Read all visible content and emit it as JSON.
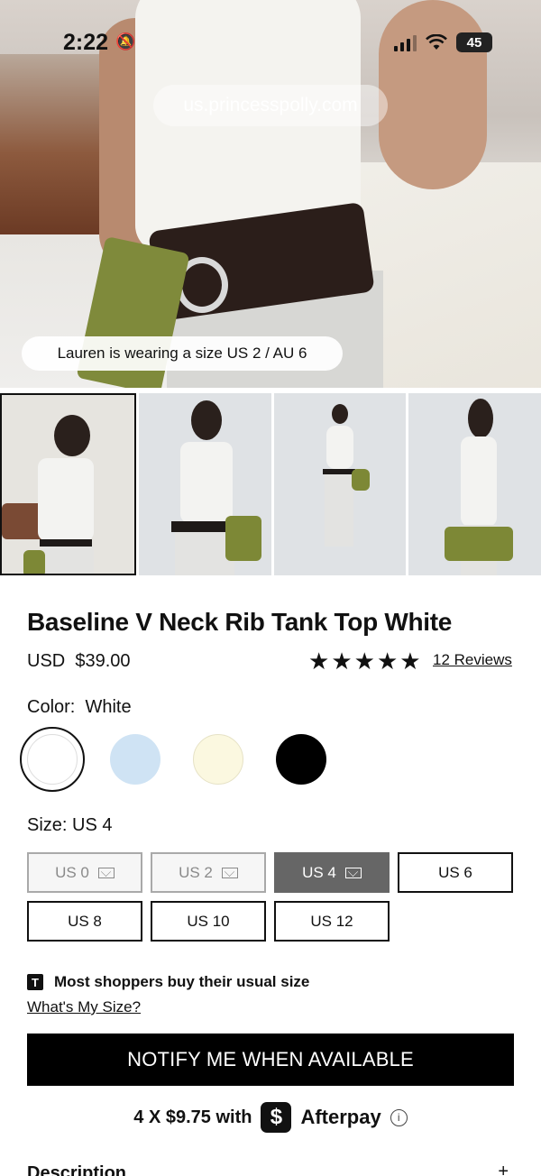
{
  "status_bar": {
    "time": "2:22",
    "battery": "45",
    "icons": [
      "bell-slash-icon",
      "signal-icon",
      "wifi-icon",
      "battery-icon"
    ]
  },
  "browser": {
    "url": "us.princesspolly.com"
  },
  "hero": {
    "model_note": "Lauren is wearing a size US 2 / AU 6"
  },
  "gallery": {
    "thumbnails": [
      "thumb-1",
      "thumb-2",
      "thumb-3",
      "thumb-4"
    ],
    "selected_index": 0
  },
  "product": {
    "title": "Baseline V Neck Rib Tank Top White",
    "currency": "USD",
    "price": "$39.00",
    "rating_stars": 5,
    "reviews": "12 Reviews"
  },
  "color": {
    "label": "Color:",
    "selected": "White",
    "swatches": [
      {
        "name": "white",
        "hex": "#ffffff"
      },
      {
        "name": "light-blue",
        "hex": "#cfe3f4"
      },
      {
        "name": "cream",
        "hex": "#fbf8e0"
      },
      {
        "name": "black",
        "hex": "#000000"
      }
    ]
  },
  "size": {
    "label": "Size: US 4",
    "options": [
      {
        "label": "US 0",
        "state": "oos"
      },
      {
        "label": "US 2",
        "state": "oos"
      },
      {
        "label": "US 4",
        "state": "active"
      },
      {
        "label": "US 6",
        "state": "available"
      },
      {
        "label": "US 8",
        "state": "available"
      },
      {
        "label": "US 10",
        "state": "available"
      },
      {
        "label": "US 12",
        "state": "available"
      }
    ]
  },
  "fit": {
    "badge": "T",
    "message": "Most shoppers buy their usual size",
    "link": "What's My Size?"
  },
  "cta": {
    "label": "NOTIFY ME WHEN AVAILABLE"
  },
  "afterpay": {
    "text": "4 X $9.75 with",
    "logo_symbol": "$",
    "brand": "Afterpay",
    "info": "i"
  },
  "description": {
    "label": "Description",
    "toggle": "+"
  },
  "colors": {
    "cta_bg": "#000000",
    "active_size_bg": "#666666"
  }
}
